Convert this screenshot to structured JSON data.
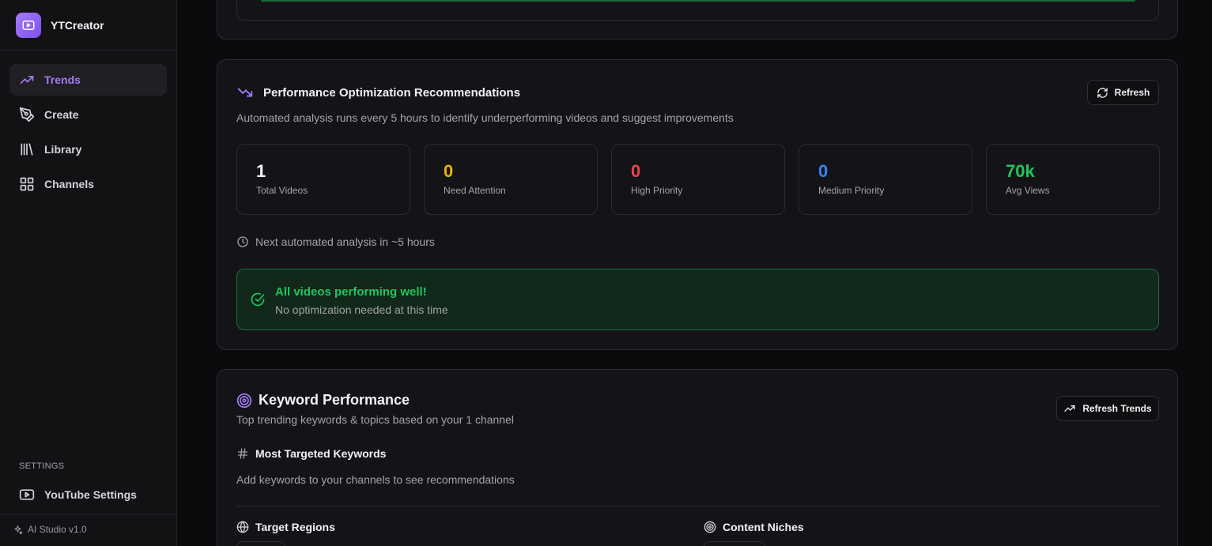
{
  "app": {
    "name": "YTCreator",
    "version": "AI Studio v1.0"
  },
  "sidebar": {
    "items": [
      {
        "label": "Trends",
        "icon": "trending-up-icon",
        "active": true
      },
      {
        "label": "Create",
        "icon": "pen-tool-icon",
        "active": false
      },
      {
        "label": "Library",
        "icon": "library-icon",
        "active": false
      },
      {
        "label": "Channels",
        "icon": "grid-icon",
        "active": false
      }
    ],
    "settings_label": "SETTINGS",
    "settings_items": [
      {
        "label": "YouTube Settings",
        "icon": "youtube-icon"
      }
    ]
  },
  "performance": {
    "title": "Performance Optimization Recommendations",
    "subtitle": "Automated analysis runs every 5 hours to identify underperforming videos and suggest improvements",
    "refresh_label": "Refresh",
    "stats": [
      {
        "value": "1",
        "label": "Total Videos",
        "color": "#f2f2f5"
      },
      {
        "value": "0",
        "label": "Need Attention",
        "color": "#eab308"
      },
      {
        "value": "0",
        "label": "High Priority",
        "color": "#ef4444"
      },
      {
        "value": "0",
        "label": "Medium Priority",
        "color": "#3b82f6"
      },
      {
        "value": "70k",
        "label": "Avg Views",
        "color": "#22c55e"
      }
    ],
    "next_analysis": "Next automated analysis in ~5 hours",
    "status_title": "All videos performing well!",
    "status_subtitle": "No optimization needed at this time"
  },
  "keywords": {
    "title": "Keyword Performance",
    "subtitle": "Top trending keywords & topics based on your 1 channel",
    "refresh_label": "Refresh Trends",
    "most_targeted_title": "Most Targeted Keywords",
    "most_targeted_empty": "Add keywords to your channels to see recommendations",
    "target_regions_title": "Target Regions",
    "content_niches_title": "Content Niches"
  },
  "colors": {
    "accent": "#a67cf6",
    "success": "#22c55e",
    "warning": "#eab308",
    "danger": "#ef4444",
    "info": "#3b82f6"
  }
}
